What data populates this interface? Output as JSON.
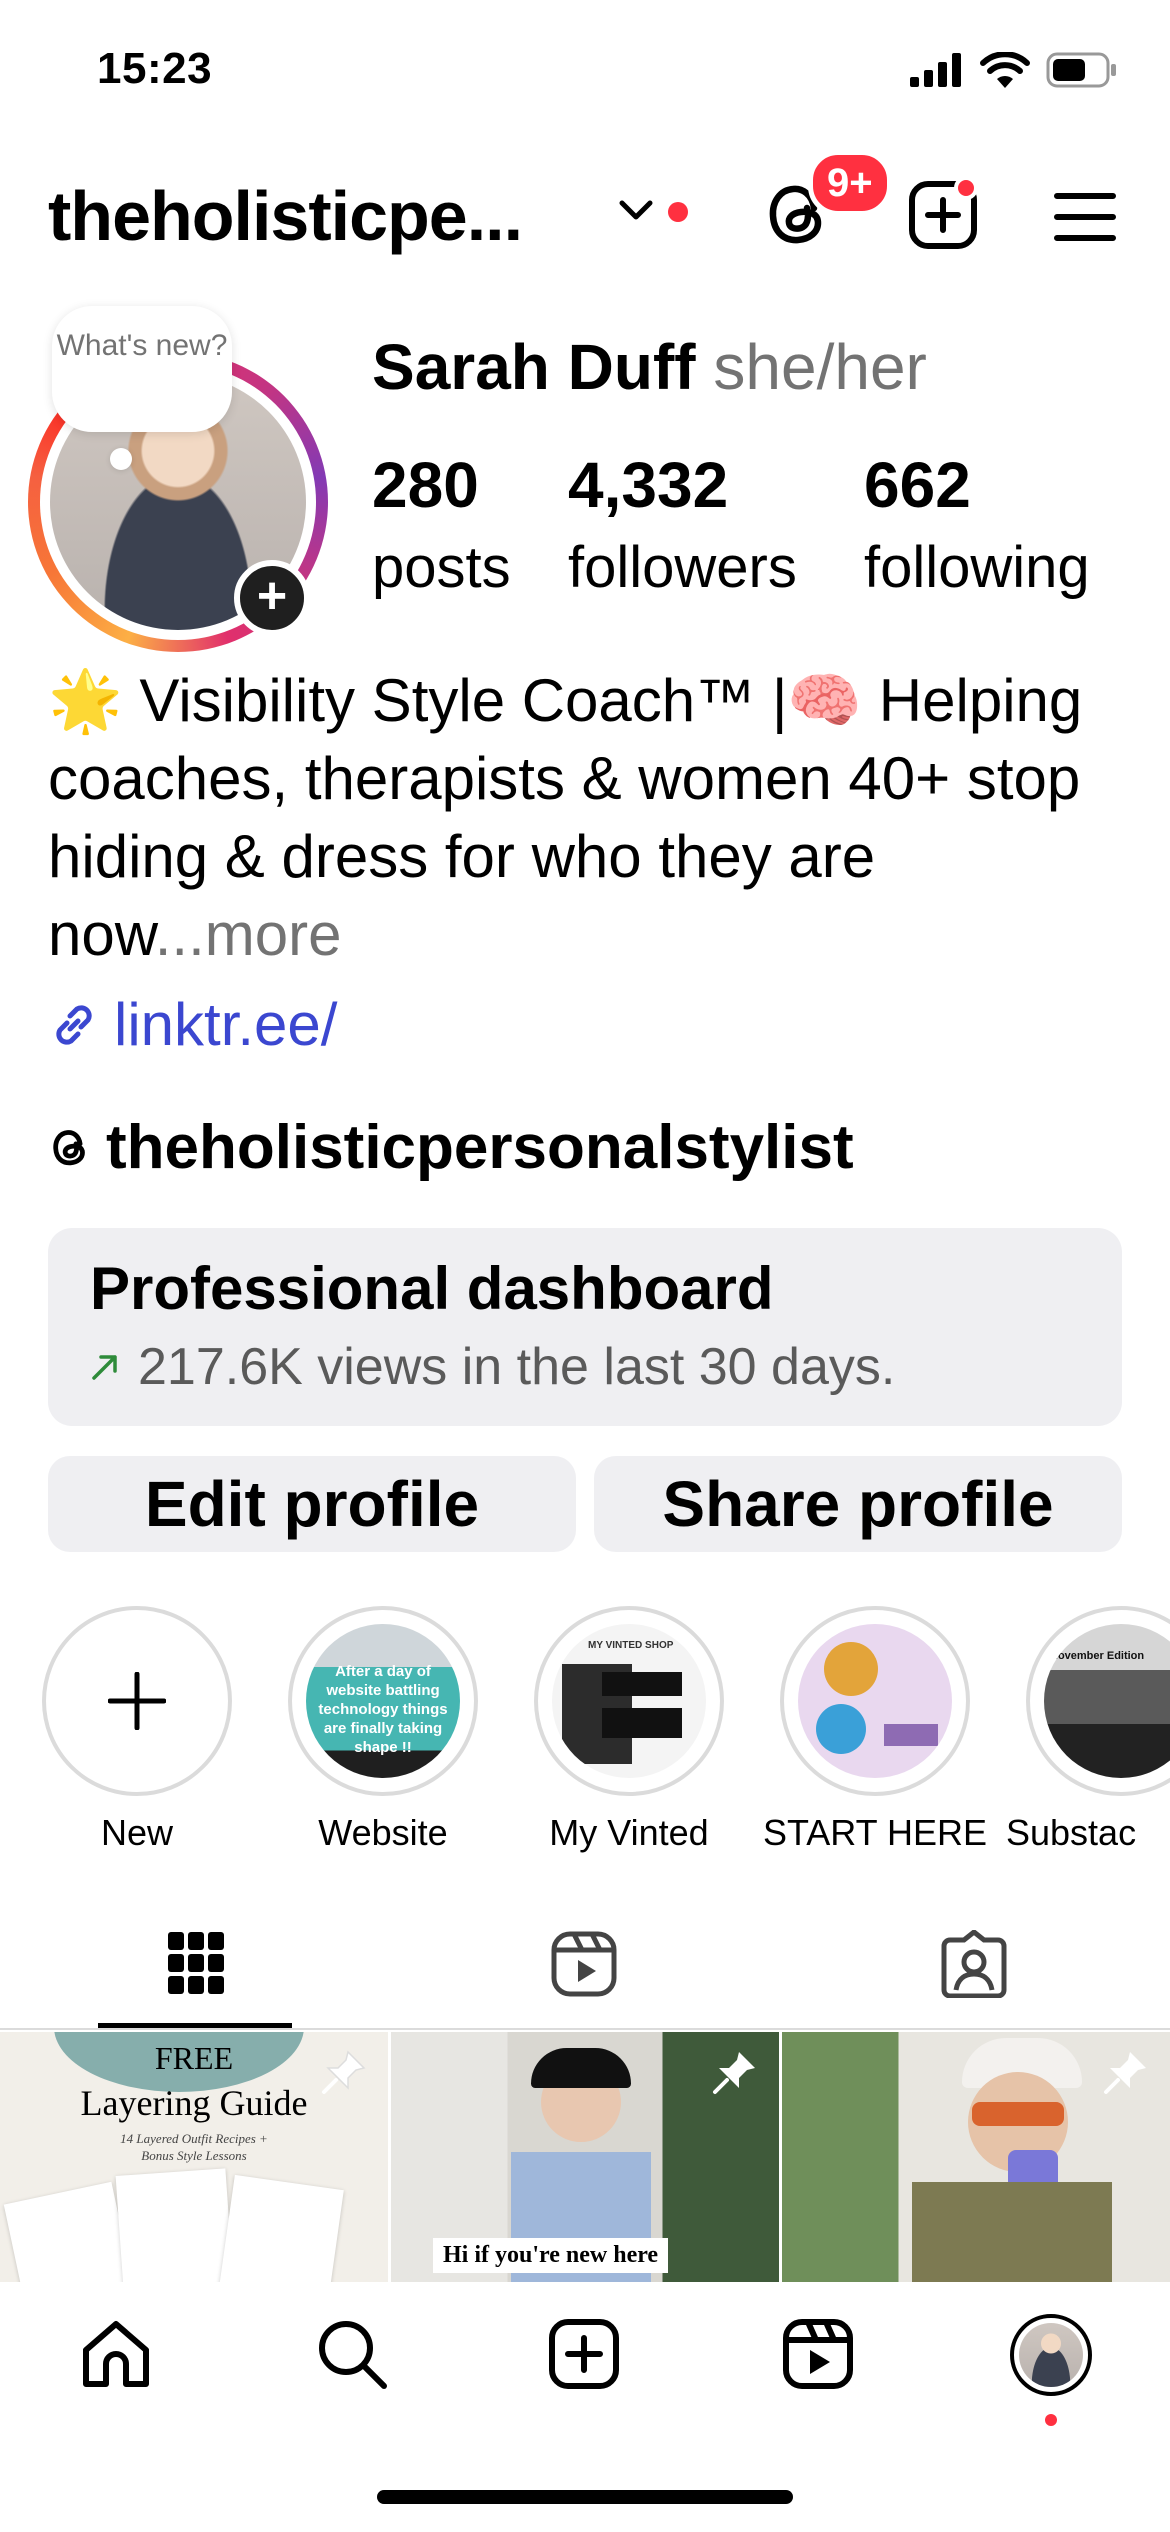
{
  "status_bar": {
    "time": "15:23"
  },
  "header": {
    "username": "theholisticpe...",
    "notification_badge": "9+"
  },
  "avatar": {
    "bubble_text": "What's new?",
    "add_symbol": "+"
  },
  "profile": {
    "name": "Sarah Duff",
    "pronouns": "she/her",
    "stats": [
      {
        "value": "280",
        "label": "posts"
      },
      {
        "value": "4,332",
        "label": "followers"
      },
      {
        "value": "662",
        "label": "following"
      }
    ],
    "bio_text": "🌟 Visibility Style Coach™ |🧠 Helping coaches, therapists & women 40+ stop hiding & dress for who they are now",
    "bio_ellipsis": "...",
    "bio_more": "more",
    "link": "linktr.ee/",
    "threads_handle": "theholisticpersonalstylist"
  },
  "dashboard": {
    "title": "Professional dashboard",
    "stat": "217.6K views in the last 30 days."
  },
  "buttons": {
    "edit": "Edit profile",
    "share": "Share profile"
  },
  "highlights": [
    {
      "label": "New",
      "icon": "plus-icon"
    },
    {
      "label": "Website",
      "thumb_text": "After a day of website battling technology things are finally taking shape !!"
    },
    {
      "label": "My Vinted",
      "thumb_text": "MY VINTED SHOP"
    },
    {
      "label": "START HERE"
    },
    {
      "label": "Substac",
      "thumb_text": "November Edition"
    }
  ],
  "tabs": [
    "grid-icon",
    "reels-icon",
    "tagged-icon"
  ],
  "grid": [
    {
      "line1": "FREE",
      "line2": "Layering Guide",
      "line3": "14 Layered Outfit Recipes + Bonus Style Lessons",
      "pinned": true
    },
    {
      "caption": "Hi if you're new here",
      "pinned": true
    },
    {
      "pinned": true
    }
  ],
  "bottom_nav": [
    "home-icon",
    "search-icon",
    "create-icon",
    "reels-icon",
    "profile-avatar"
  ],
  "colors": {
    "accent_red": "#ff3040",
    "link_blue": "#3b47d0",
    "surface": "#efeff2",
    "muted": "#737373"
  }
}
